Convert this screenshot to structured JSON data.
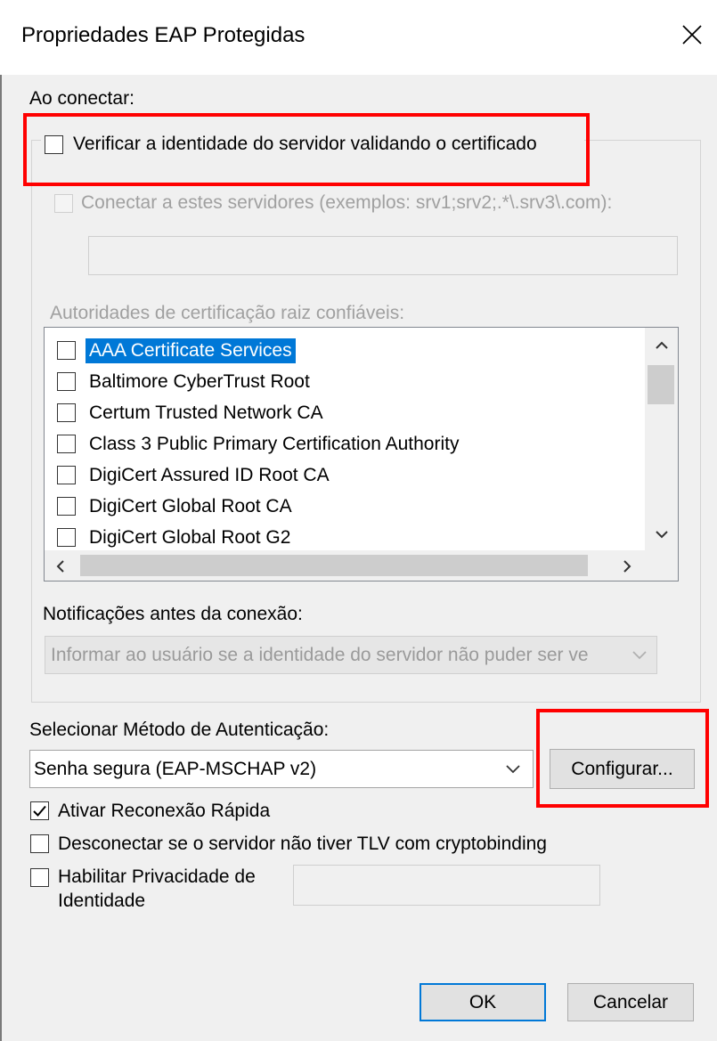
{
  "window": {
    "title": "Propriedades EAP Protegidas"
  },
  "connect": {
    "section_label": "Ao conectar:",
    "verify_server_label": "Verificar a identidade do servidor validando o certificado",
    "verify_server_checked": false,
    "connect_servers_label": "Conectar a estes servidores (exemplos: srv1;srv2;.*\\.srv3\\.com):",
    "connect_servers_checked": false,
    "servers_value": "",
    "trusted_roots_label": "Autoridades de certificação raiz confiáveis:",
    "certificates": [
      {
        "name": "AAA Certificate Services",
        "checked": false,
        "selected": true
      },
      {
        "name": "Baltimore CyberTrust Root",
        "checked": false,
        "selected": false
      },
      {
        "name": "Certum Trusted Network CA",
        "checked": false,
        "selected": false
      },
      {
        "name": "Class 3 Public Primary Certification Authority",
        "checked": false,
        "selected": false
      },
      {
        "name": "DigiCert Assured ID Root CA",
        "checked": false,
        "selected": false
      },
      {
        "name": "DigiCert Global Root CA",
        "checked": false,
        "selected": false
      },
      {
        "name": "DigiCert Global Root G2",
        "checked": false,
        "selected": false
      }
    ],
    "notifications_label": "Notificações antes da conexão:",
    "notifications_value": "Informar ao usuário se a identidade do servidor não puder ser ve"
  },
  "auth": {
    "method_label": "Selecionar Método de Autenticação:",
    "method_value": "Senha segura (EAP-MSCHAP v2)",
    "configure_label": "Configurar..."
  },
  "options": {
    "fast_reconnect_label": "Ativar Reconexão Rápida",
    "fast_reconnect_checked": true,
    "disconnect_tlv_label": "Desconectar se o servidor não tiver TLV com cryptobinding",
    "disconnect_tlv_checked": false,
    "identity_privacy_label_line1": "Habilitar Privacidade de",
    "identity_privacy_label_line2": "Identidade",
    "identity_privacy_checked": false,
    "identity_privacy_value": ""
  },
  "footer": {
    "ok_label": "OK",
    "cancel_label": "Cancelar"
  },
  "colors": {
    "highlight": "#ff0000",
    "selection": "#0078d7",
    "dialog_bg": "#f0f0f0"
  },
  "icons": [
    "close-icon",
    "chevron-down-icon",
    "chevron-up-icon",
    "chevron-left-icon",
    "chevron-right-icon",
    "checkmark-icon"
  ]
}
